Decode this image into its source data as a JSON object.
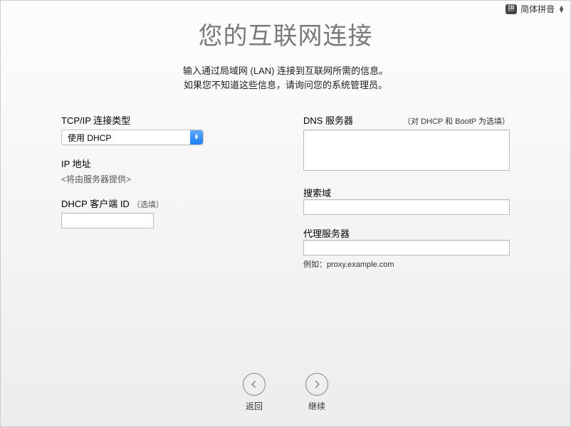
{
  "menubar": {
    "ime_badge": "拼",
    "ime_label": "简体拼音"
  },
  "header": {
    "title": "您的互联网连接",
    "subtitle_line1": "输入通过局域网 (LAN) 连接到互联网所需的信息。",
    "subtitle_line2": "如果您不知道这些信息，请询问您的系统管理员。"
  },
  "left": {
    "tcpip_label": "TCP/IP 连接类型",
    "tcpip_selected": "使用 DHCP",
    "ip_label": "IP 地址",
    "ip_placeholder": "<将由服务器提供>",
    "dhcp_client_label": "DHCP 客户端 ID",
    "dhcp_client_hint": "（选填）",
    "dhcp_client_value": ""
  },
  "right": {
    "dns_label": "DNS 服务器",
    "dns_hint": "（对 DHCP 和 BootP 为选填）",
    "dns_value": "",
    "search_label": "搜索域",
    "search_value": "",
    "proxy_label": "代理服务器",
    "proxy_value": "",
    "proxy_example": "例如：proxy.example.com"
  },
  "footer": {
    "back": "返回",
    "continue": "继续"
  }
}
